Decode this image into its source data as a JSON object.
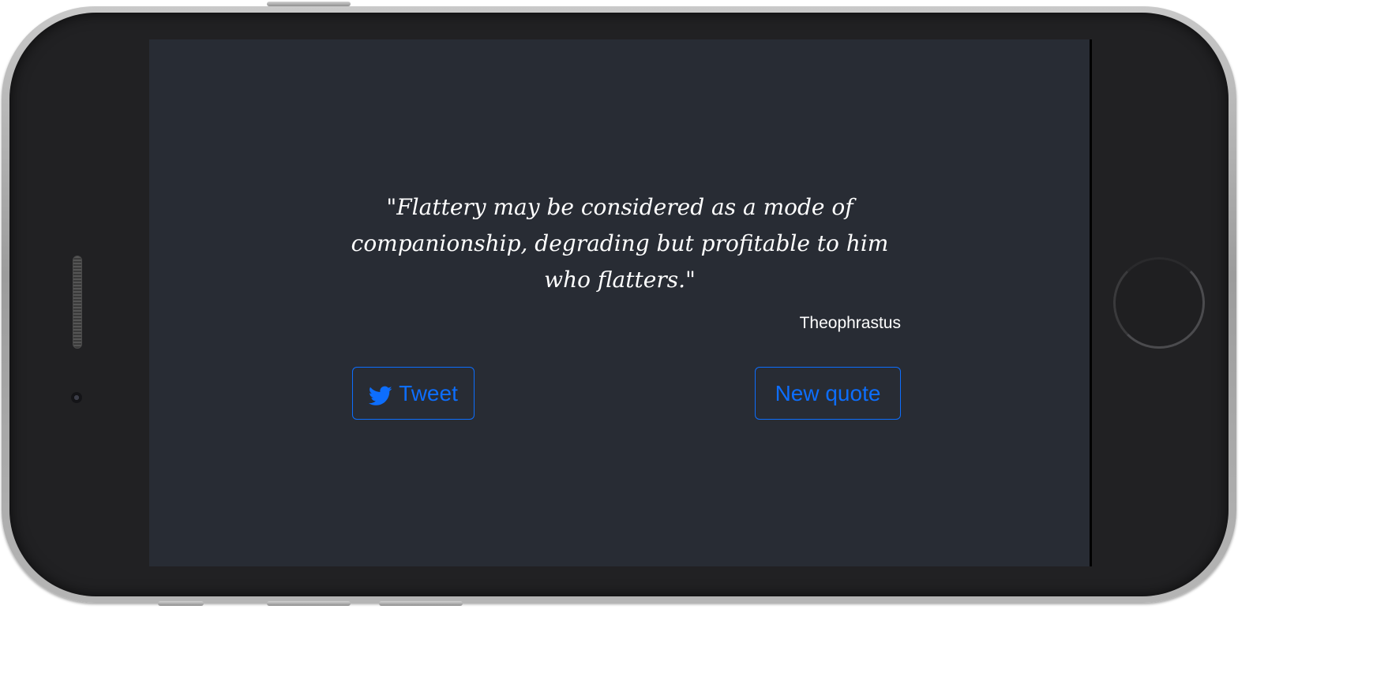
{
  "quote": {
    "text": "\"Flattery may be considered as a mode of companionship, degrading but profitable to him who flatters.\"",
    "author": "Theophrastus"
  },
  "buttons": {
    "tweet_label": "Tweet",
    "tweet_icon": "twitter-bird-icon",
    "new_quote_label": "New quote"
  },
  "colors": {
    "background": "#282c34",
    "accent": "#0d6efd",
    "text": "#ffffff"
  }
}
